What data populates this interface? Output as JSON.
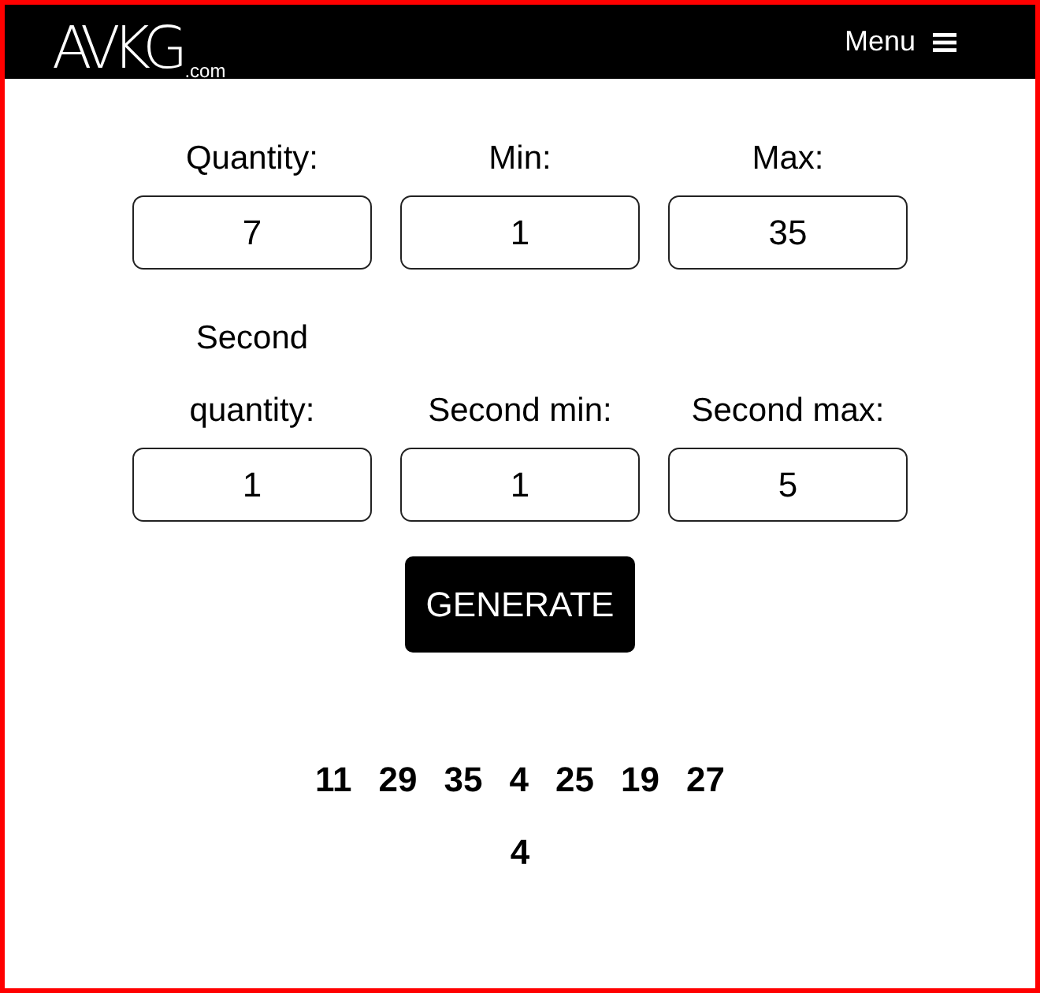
{
  "header": {
    "logo": {
      "text": "AVKG",
      "suffix": ".com"
    },
    "menu": {
      "label": "Menu"
    }
  },
  "fields": [
    {
      "label": "Quantity:",
      "value": "7"
    },
    {
      "label": "Min:",
      "value": "1"
    },
    {
      "label": "Max:",
      "value": "35"
    },
    {
      "label": "Second quantity:",
      "value": "1"
    },
    {
      "label": "Second min:",
      "value": "1"
    },
    {
      "label": "Second max:",
      "value": "5"
    }
  ],
  "generate_button": {
    "label": "GENERATE"
  },
  "results": [
    "11",
    "29",
    "35",
    "4",
    "25",
    "19",
    "27",
    "4"
  ]
}
